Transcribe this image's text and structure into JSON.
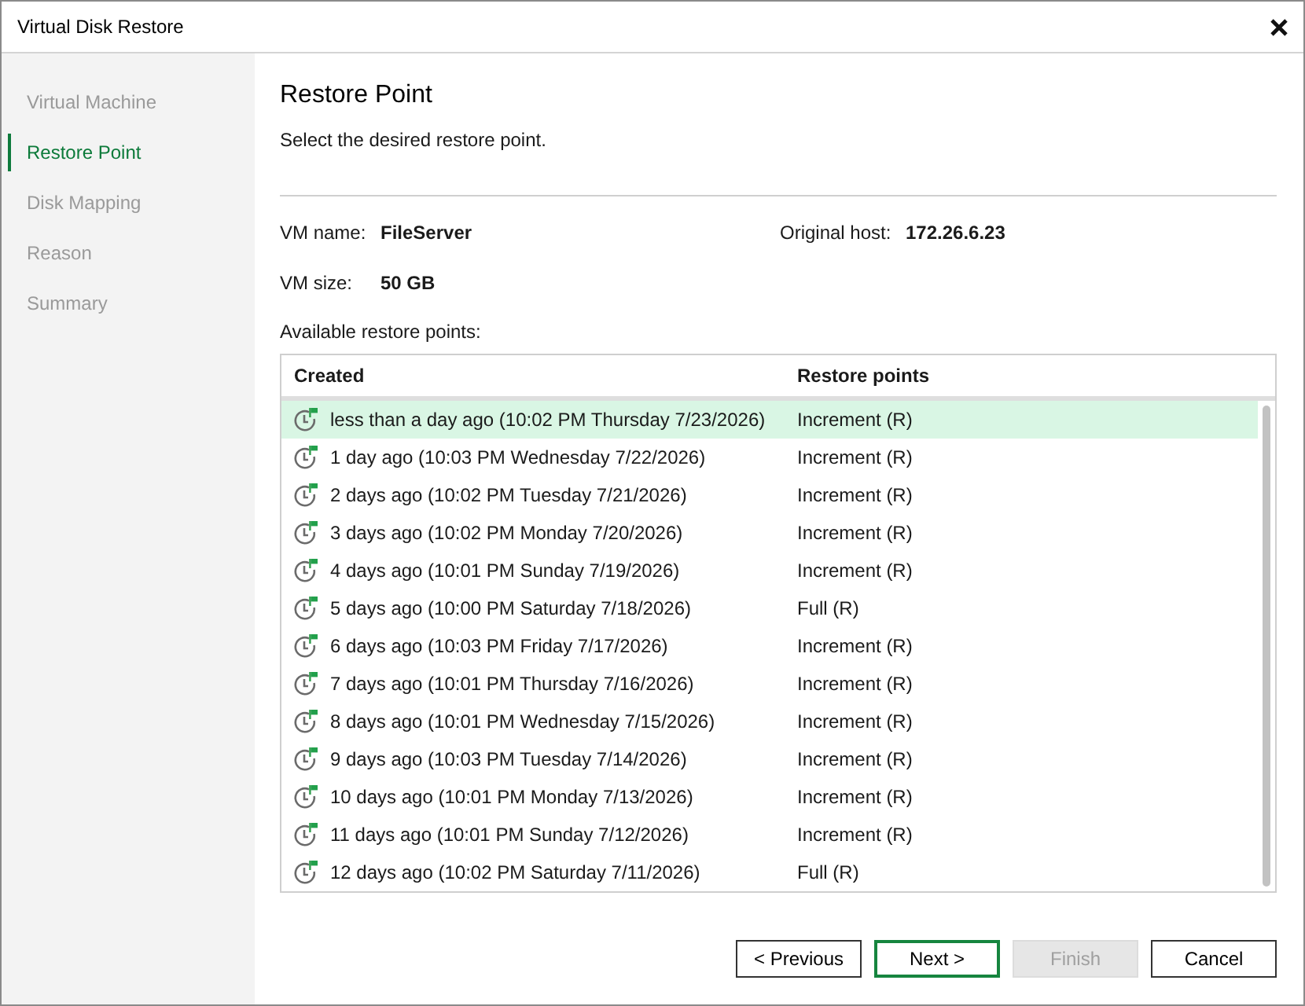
{
  "window": {
    "title": "Virtual Disk Restore"
  },
  "sidebar": {
    "items": [
      {
        "label": "Virtual Machine",
        "selected": false
      },
      {
        "label": "Restore Point",
        "selected": true
      },
      {
        "label": "Disk Mapping",
        "selected": false
      },
      {
        "label": "Reason",
        "selected": false
      },
      {
        "label": "Summary",
        "selected": false
      }
    ]
  },
  "page": {
    "title": "Restore Point",
    "subtitle": "Select the desired restore point."
  },
  "vm_info": {
    "vm_name_label": "VM name:",
    "vm_name": "FileServer",
    "vm_size_label": "VM size:",
    "vm_size": "50 GB",
    "host_label": "Original host:",
    "host": "172.26.6.23"
  },
  "restore_points": {
    "label": "Available restore points:",
    "columns": [
      "Created",
      "Restore points"
    ],
    "rows": [
      {
        "created": "less than a day ago (10:02 PM Thursday 7/23/2026)",
        "type": "Increment (R)",
        "selected": true
      },
      {
        "created": "1 day ago (10:03 PM Wednesday 7/22/2026)",
        "type": "Increment (R)",
        "selected": false
      },
      {
        "created": "2 days ago (10:02 PM Tuesday 7/21/2026)",
        "type": "Increment (R)",
        "selected": false
      },
      {
        "created": "3 days ago (10:02 PM Monday 7/20/2026)",
        "type": "Increment (R)",
        "selected": false
      },
      {
        "created": "4 days ago (10:01 PM Sunday 7/19/2026)",
        "type": "Increment (R)",
        "selected": false
      },
      {
        "created": "5 days ago (10:00 PM Saturday 7/18/2026)",
        "type": "Full (R)",
        "selected": false
      },
      {
        "created": "6 days ago (10:03 PM Friday 7/17/2026)",
        "type": "Increment (R)",
        "selected": false
      },
      {
        "created": "7 days ago (10:01 PM Thursday 7/16/2026)",
        "type": "Increment (R)",
        "selected": false
      },
      {
        "created": "8 days ago (10:01 PM Wednesday 7/15/2026)",
        "type": "Increment (R)",
        "selected": false
      },
      {
        "created": "9 days ago (10:03 PM Tuesday 7/14/2026)",
        "type": "Increment (R)",
        "selected": false
      },
      {
        "created": "10 days ago (10:01 PM Monday 7/13/2026)",
        "type": "Increment (R)",
        "selected": false
      },
      {
        "created": "11 days ago (10:01 PM Sunday 7/12/2026)",
        "type": "Increment (R)",
        "selected": false
      },
      {
        "created": "12 days ago (10:02 PM Saturday 7/11/2026)",
        "type": "Full (R)",
        "selected": false
      }
    ]
  },
  "buttons": [
    {
      "label": "< Previous",
      "default": false,
      "disabled": false
    },
    {
      "label": "Next >",
      "default": true,
      "disabled": false
    },
    {
      "label": "Finish",
      "default": false,
      "disabled": true
    },
    {
      "label": "Cancel",
      "default": false,
      "disabled": false
    }
  ]
}
